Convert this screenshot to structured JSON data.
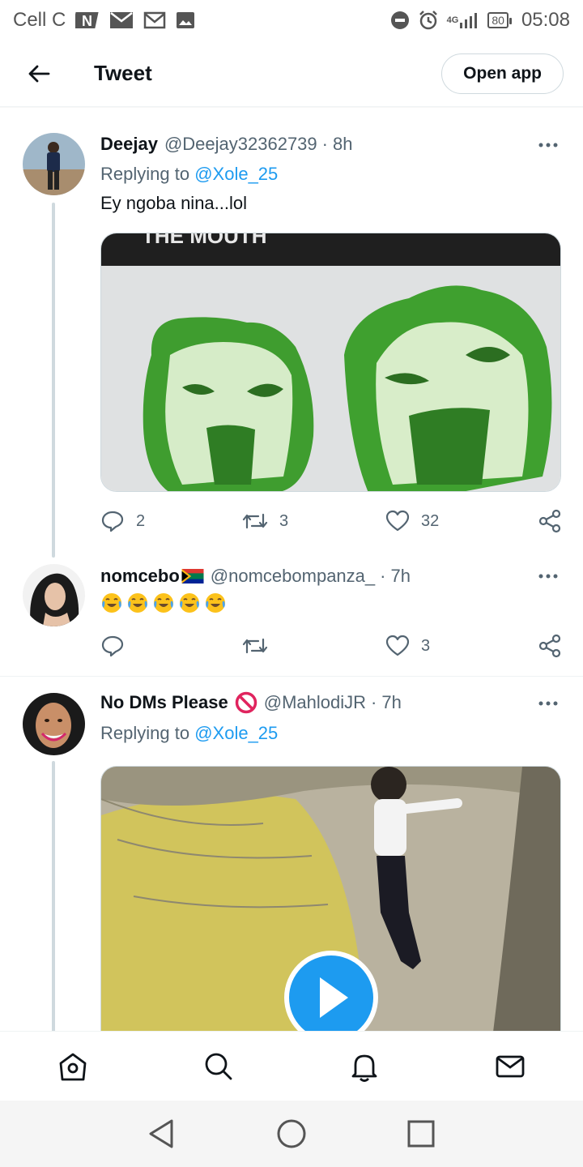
{
  "status_bar": {
    "carrier": "Cell C",
    "battery": "80",
    "time": "05:08",
    "network": "4G"
  },
  "header": {
    "title": "Tweet",
    "open_app_label": "Open app"
  },
  "tweets": [
    {
      "name": "Deejay",
      "handle": "@Deejay32362739",
      "time": "8h",
      "replying_prefix": "Replying to",
      "replying_to": "@Xole_25",
      "text": "Ey ngoba nina...lol",
      "media_caption": "THE MOUTH",
      "replies": "2",
      "retweets": "3",
      "likes": "32"
    },
    {
      "name": "nomcebo",
      "handle": "@nomcebompanza_",
      "time": "7h",
      "likes": "3"
    },
    {
      "name": "No DMs Please",
      "handle": "@MahlodiJR",
      "time": "7h",
      "replying_prefix": "Replying to",
      "replying_to": "@Xole_25"
    }
  ],
  "colors": {
    "accent": "#1d9bf0",
    "secondary_text": "#536471",
    "border": "#cfd9de"
  },
  "icons": {
    "bottom_nav": [
      "home-icon",
      "search-icon",
      "bell-icon",
      "mail-icon"
    ],
    "system_nav": [
      "back-triangle-icon",
      "home-circle-icon",
      "recents-square-icon"
    ]
  }
}
